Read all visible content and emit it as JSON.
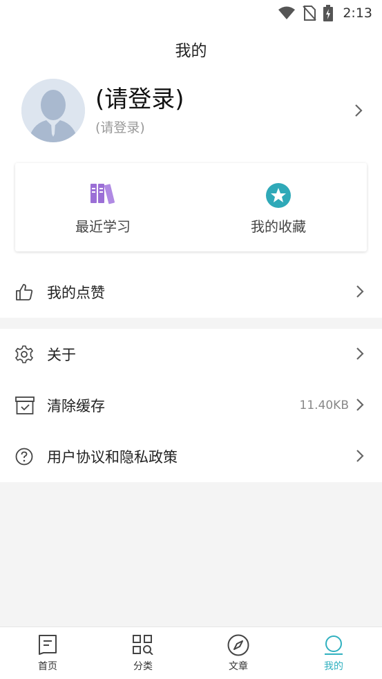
{
  "status": {
    "time": "2:13"
  },
  "header": {
    "title": "我的"
  },
  "profile": {
    "name": "(请登录)",
    "subtitle": "(请登录)"
  },
  "quick_actions": [
    {
      "label": "最近学习",
      "icon": "books-icon"
    },
    {
      "label": "我的收藏",
      "icon": "star-badge-icon"
    }
  ],
  "menu": [
    {
      "label": "我的点赞",
      "icon": "thumb-up-icon",
      "value": ""
    },
    {
      "label": "关于",
      "icon": "gear-icon",
      "value": ""
    },
    {
      "label": "清除缓存",
      "icon": "archive-box-icon",
      "value": "11.40KB"
    },
    {
      "label": "用户协议和隐私政策",
      "icon": "help-circle-icon",
      "value": ""
    }
  ],
  "bottom_nav": [
    {
      "label": "首页",
      "icon": "home-doc-icon",
      "active": false
    },
    {
      "label": "分类",
      "icon": "category-grid-icon",
      "active": false
    },
    {
      "label": "文章",
      "icon": "compass-icon",
      "active": false
    },
    {
      "label": "我的",
      "icon": "profile-icon",
      "active": true
    }
  ],
  "colors": {
    "accent": "#2fb0bf",
    "books": "#9b6fd6",
    "star_badge": "#2fa9b8"
  }
}
